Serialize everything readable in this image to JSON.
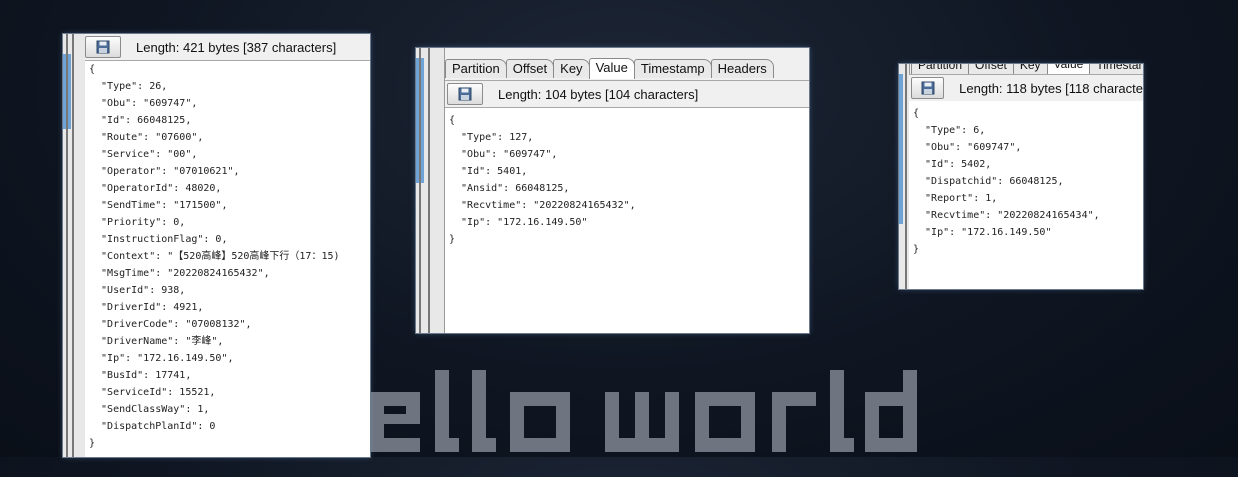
{
  "panel1": {
    "length": "Length: 421 bytes [387 characters]",
    "lines": [
      "{",
      "  \"Type\": 26,",
      "  \"Obu\": \"609747\",",
      "  \"Id\": 66048125,",
      "  \"Route\": \"07600\",",
      "  \"Service\": \"00\",",
      "  \"Operator\": \"07010621\",",
      "  \"OperatorId\": 48020,",
      "  \"SendTime\": \"171500\",",
      "  \"Priority\": 0,",
      "  \"InstructionFlag\": 0,",
      "  \"Context\": \"【520高峰】520高峰下行（17：15)",
      "  \"MsgTime\": \"20220824165432\",",
      "  \"UserId\": 938,",
      "  \"DriverId\": 4921,",
      "  \"DriverCode\": \"07008132\",",
      "  \"DriverName\": \"李峰\",",
      "  \"Ip\": \"172.16.149.50\",",
      "  \"BusId\": 17741,",
      "  \"ServiceId\": 15521,",
      "  \"SendClassWay\": 1,",
      "  \"DispatchPlanId\": 0",
      "}"
    ]
  },
  "panel2": {
    "tabs": [
      "Partition",
      "Offset",
      "Key",
      "Value",
      "Timestamp",
      "Headers"
    ],
    "active_tab": "Value",
    "length": "Length: 104 bytes [104 characters]",
    "lines": [
      "{",
      "  \"Type\": 127,",
      "  \"Obu\": \"609747\",",
      "  \"Id\": 5401,",
      "  \"Ansid\": 66048125,",
      "  \"Recvtime\": \"20220824165432\",",
      "  \"Ip\": \"172.16.149.50\"",
      "}"
    ]
  },
  "panel3": {
    "tabs": [
      "Partition",
      "Offset",
      "Key",
      "Value",
      "Timestamp"
    ],
    "length": "Length: 118 bytes [118 characte",
    "lines": [
      "{",
      "  \"Type\": 6,",
      "  \"Obu\": \"609747\",",
      "  \"Id\": 5402,",
      "  \"Dispatchid\": 66048125,",
      "  \"Report\": 1,",
      "  \"Recvtime\": \"20220824165434\",",
      "  \"Ip\": \"172.16.149.50\"",
      "}"
    ]
  },
  "wallpaper": {
    "text": "ello world"
  }
}
